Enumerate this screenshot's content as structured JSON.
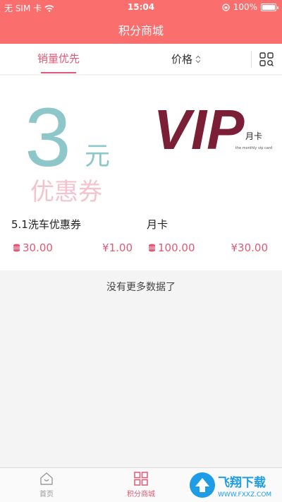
{
  "status_bar": {
    "carrier": "无 SIM 卡",
    "time": "15:04",
    "battery": "100%",
    "battery_level": 1.0
  },
  "header": {
    "title": "积分商城"
  },
  "filters": {
    "tabs": [
      {
        "label": "销量优先",
        "active": true
      },
      {
        "label": "价格",
        "active": false
      }
    ],
    "layout_toggle_icon": "grid-view-icon"
  },
  "products": [
    {
      "name": "5.1洗车优惠券",
      "points": "30.00",
      "price": "¥1.00",
      "image": {
        "kind": "coupon",
        "big_text": "3",
        "small_text": "元",
        "sub_text": "优惠券"
      }
    },
    {
      "name": "月卡",
      "points": "100.00",
      "price": "¥30.00",
      "image": {
        "kind": "vip",
        "big_text": "VIP",
        "small_text": "月卡",
        "tagline": "the monthly vip card"
      }
    }
  ],
  "footer_text": "没有更多数据了",
  "bottom_nav": [
    {
      "label": "首页",
      "icon": "home-icon",
      "active": false
    },
    {
      "label": "积分商城",
      "icon": "grid-icon",
      "active": true
    }
  ],
  "watermark": {
    "text": "飞翔下载",
    "url": "WWW.FXXZ.COM"
  },
  "colors": {
    "brand": "#fb6e6e",
    "accent": "#e05a78",
    "coupon_teal": "#8ec7c9",
    "coupon_pink": "#f3c4cf",
    "vip_maroon": "#7a1f35"
  }
}
